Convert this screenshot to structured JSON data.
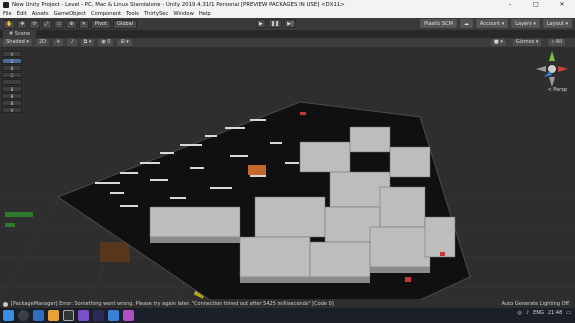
{
  "window": {
    "title": "New Unity Project - Level - PC, Mac & Linux Standalone - Unity 2019.4.31f1 Personal [PREVIEW PACKAGES IN USE] <DX11>",
    "controls": [
      "–",
      "□",
      "✕"
    ]
  },
  "menu": [
    "File",
    "Edit",
    "Assets",
    "GameObject",
    "Component",
    "Tools",
    "ThirtySec",
    "Window",
    "Help"
  ],
  "toolbar": {
    "pivot_label": "Pivot",
    "global_label": "Global",
    "plastic_label": "Plastic SCM",
    "account_label": "Account",
    "layers_label": "Layers",
    "layout_label": "Layout"
  },
  "scene": {
    "tab_label": "Scene",
    "shading_mode": "Shaded",
    "mode_2d": "2D",
    "gizmos_label": "Gizmos",
    "search_label": "All",
    "persp_label": "< Persp"
  },
  "left_tools": [
    "V",
    "Z",
    "B",
    "C",
    "",
    "B",
    "B",
    "B",
    "V"
  ],
  "status": {
    "message": "[PackageManager] Error: Something went wrong. Please try again later. \"Connection timed out after 5425 milliseconds\" [Code 0]",
    "right_text": "Auto Generate Lighting Off"
  },
  "taskbar": {
    "language": "ENG",
    "time": "21:48"
  },
  "colors": {
    "accent": "#4b6b95",
    "viewport_bg": "#2b2b2b",
    "toolbar_bg": "#3a3a3a"
  }
}
